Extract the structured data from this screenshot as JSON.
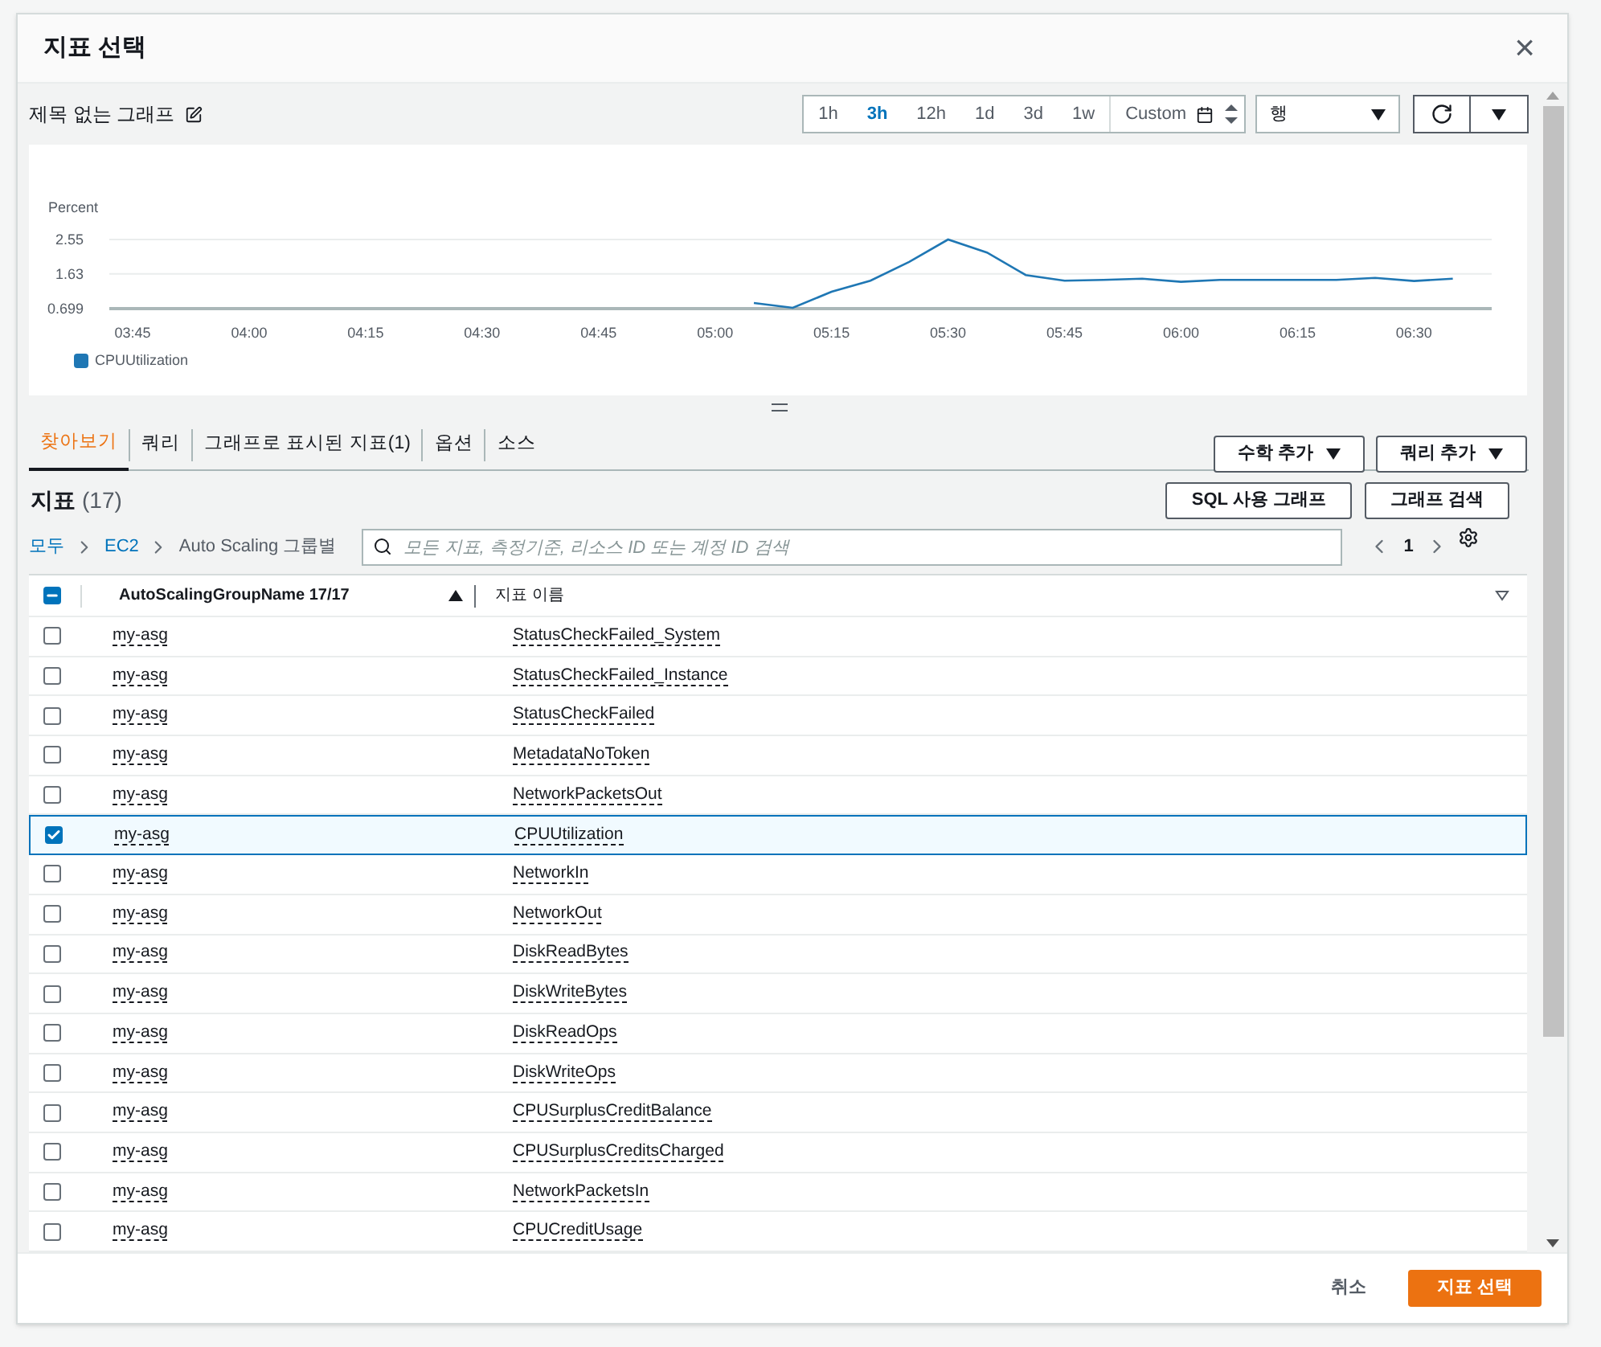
{
  "dialog": {
    "title": "지표 선택",
    "close": "×"
  },
  "graph": {
    "title": "제목 없는 그래프",
    "time_ranges": [
      {
        "label": "1h",
        "selected": false
      },
      {
        "label": "3h",
        "selected": true
      },
      {
        "label": "12h",
        "selected": false
      },
      {
        "label": "1d",
        "selected": false
      },
      {
        "label": "3d",
        "selected": false
      },
      {
        "label": "1w",
        "selected": false
      }
    ],
    "custom": "Custom",
    "view_select": "행",
    "chart_data": {
      "type": "line",
      "ylabel": "Percent",
      "x": [
        305,
        310,
        315,
        320,
        325,
        330,
        335,
        340,
        345,
        350,
        355,
        360,
        365,
        370,
        375,
        380,
        385,
        390,
        395
      ],
      "series": [
        {
          "name": "CPUUtilization",
          "color": "#1f77b4",
          "values": [
            0.85,
            0.72,
            1.15,
            1.45,
            1.95,
            2.55,
            2.2,
            1.6,
            1.45,
            1.47,
            1.5,
            1.42,
            1.47,
            1.47,
            1.47,
            1.47,
            1.52,
            1.44,
            1.5
          ]
        }
      ],
      "xticks": [
        {
          "value": 225,
          "label": "03:45"
        },
        {
          "value": 240,
          "label": "04:00"
        },
        {
          "value": 255,
          "label": "04:15"
        },
        {
          "value": 270,
          "label": "04:30"
        },
        {
          "value": 285,
          "label": "04:45"
        },
        {
          "value": 300,
          "label": "05:00"
        },
        {
          "value": 315,
          "label": "05:15"
        },
        {
          "value": 330,
          "label": "05:30"
        },
        {
          "value": 345,
          "label": "05:45"
        },
        {
          "value": 360,
          "label": "06:00"
        },
        {
          "value": 375,
          "label": "06:15"
        },
        {
          "value": 390,
          "label": "06:30"
        }
      ],
      "xlim": [
        222,
        400
      ],
      "yticks": [
        0.699,
        1.63,
        2.55
      ],
      "ylim": [
        0.699,
        2.55
      ]
    }
  },
  "tabs": [
    {
      "label": "찾아보기",
      "selected": true
    },
    {
      "label": "쿼리",
      "selected": false
    },
    {
      "label": "그래프로 표시된 지표(1)",
      "selected": false
    },
    {
      "label": "옵션",
      "selected": false
    },
    {
      "label": "소스",
      "selected": false
    }
  ],
  "tab_buttons": [
    "수학 추가",
    "쿼리 추가"
  ],
  "metrics": {
    "title": "지표",
    "count": "(17)",
    "buttons": [
      "SQL 사용 그래프",
      "그래프 검색"
    ],
    "breadcrumb": [
      {
        "label": "모두",
        "link": true
      },
      {
        "label": "EC2",
        "link": true
      },
      {
        "label": "Auto Scaling 그룹별",
        "link": false
      }
    ],
    "search": {
      "placeholder": "모든 지표, 측정기준, 리소스 ID 또는 계정 ID 검색"
    },
    "page": "1",
    "header_checkbox": {
      "indeterminate": true
    },
    "columns": [
      "AutoScalingGroupName 17/17",
      "지표 이름"
    ],
    "rows": [
      {
        "group": "my-asg",
        "metric": "StatusCheckFailed_System",
        "selected": false
      },
      {
        "group": "my-asg",
        "metric": "StatusCheckFailed_Instance",
        "selected": false
      },
      {
        "group": "my-asg",
        "metric": "StatusCheckFailed",
        "selected": false
      },
      {
        "group": "my-asg",
        "metric": "MetadataNoToken",
        "selected": false
      },
      {
        "group": "my-asg",
        "metric": "NetworkPacketsOut",
        "selected": false
      },
      {
        "group": "my-asg",
        "metric": "CPUUtilization",
        "selected": true
      },
      {
        "group": "my-asg",
        "metric": "NetworkIn",
        "selected": false
      },
      {
        "group": "my-asg",
        "metric": "NetworkOut",
        "selected": false
      },
      {
        "group": "my-asg",
        "metric": "DiskReadBytes",
        "selected": false
      },
      {
        "group": "my-asg",
        "metric": "DiskWriteBytes",
        "selected": false
      },
      {
        "group": "my-asg",
        "metric": "DiskReadOps",
        "selected": false
      },
      {
        "group": "my-asg",
        "metric": "DiskWriteOps",
        "selected": false
      },
      {
        "group": "my-asg",
        "metric": "CPUSurplusCreditBalance",
        "selected": false
      },
      {
        "group": "my-asg",
        "metric": "CPUSurplusCreditsCharged",
        "selected": false
      },
      {
        "group": "my-asg",
        "metric": "NetworkPacketsIn",
        "selected": false
      },
      {
        "group": "my-asg",
        "metric": "CPUCreditUsage",
        "selected": false
      }
    ]
  },
  "footer": {
    "cancel": "취소",
    "confirm": "지표 선택"
  }
}
